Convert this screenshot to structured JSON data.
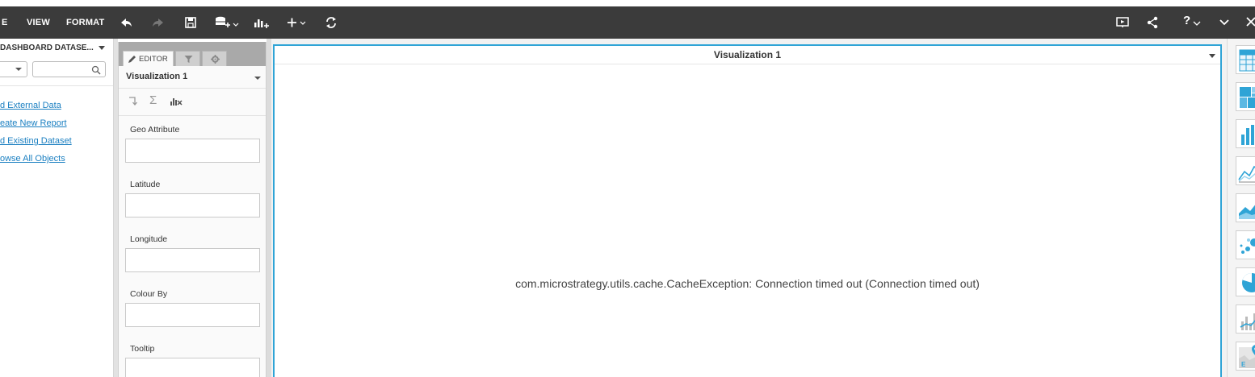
{
  "toolbar": {
    "menus": [
      "E",
      "VIEW",
      "FORMAT"
    ],
    "icons": [
      "undo-icon",
      "redo-icon",
      "save-icon",
      "add-data-icon",
      "insert-visualization-icon",
      "add-icon",
      "refresh-icon",
      "presentation-icon",
      "share-icon",
      "help-icon",
      "collapse-icon",
      "close-icon"
    ],
    "help_label": "?"
  },
  "datasets": {
    "title": "DASHBOARD DATASE...",
    "search_placeholder": "",
    "links": [
      "d External Data",
      "eate New Report",
      "d Existing Dataset",
      "owse All Objects"
    ]
  },
  "editor": {
    "tabs": [
      "EDITOR",
      "filter-icon",
      "gear-icon"
    ],
    "editor_tab_label": "EDITOR",
    "viz_name": "Visualization 1",
    "tool_icons": [
      "swap-icon",
      "sigma-icon",
      "chart-clear-icon"
    ],
    "fields": [
      {
        "label": "Geo Attribute",
        "value": ""
      },
      {
        "label": "Latitude",
        "value": ""
      },
      {
        "label": "Longitude",
        "value": ""
      },
      {
        "label": "Colour By",
        "value": ""
      },
      {
        "label": "Tooltip",
        "value": ""
      }
    ]
  },
  "visualization": {
    "title": "Visualization 1",
    "message": "com.microstrategy.utils.cache.CacheException: Connection timed out (Connection timed out)"
  },
  "gallery": {
    "items": [
      "grid-icon",
      "heatmap-icon",
      "bar-chart-icon",
      "line-chart-icon",
      "area-chart-icon",
      "bubble-chart-icon",
      "pie-chart-icon",
      "combo-chart-icon",
      "map-icon"
    ]
  },
  "colors": {
    "toolbar_bg": "#3b3b3b",
    "accent": "#2fa4d6",
    "link": "#1a7fc1"
  }
}
